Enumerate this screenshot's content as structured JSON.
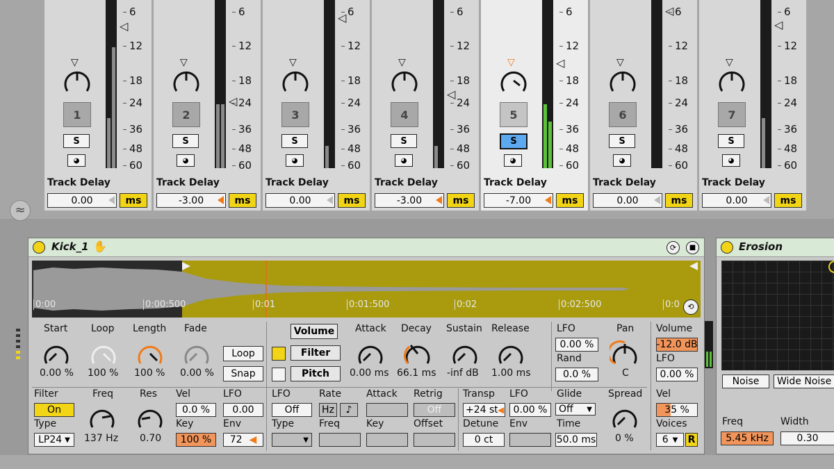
{
  "mixer": {
    "scale": [
      "6",
      "12",
      "18",
      "24",
      "36",
      "48",
      "60"
    ],
    "track_delay_label": "Track Delay",
    "solo_label": "S",
    "ms_label": "ms",
    "tracks": [
      {
        "number": "1",
        "delay": "0.00",
        "selected": false,
        "solo_on": false
      },
      {
        "number": "2",
        "delay": "-3.00",
        "selected": false,
        "solo_on": false
      },
      {
        "number": "3",
        "delay": "0.00",
        "selected": false,
        "solo_on": false
      },
      {
        "number": "4",
        "delay": "-3.00",
        "selected": false,
        "solo_on": false
      },
      {
        "number": "5",
        "delay": "-7.00",
        "selected": true,
        "solo_on": true
      },
      {
        "number": "6",
        "delay": "0.00",
        "selected": false,
        "solo_on": false
      },
      {
        "number": "7",
        "delay": "0.00",
        "selected": false,
        "solo_on": false
      }
    ]
  },
  "simpler": {
    "title": "Kick_1",
    "timeline": [
      "0:00",
      "0:00:500",
      "0:01",
      "0:01:500",
      "0:02",
      "0:02:500",
      "0:0"
    ],
    "sample": {
      "start_label": "Start",
      "start_value": "0.00 %",
      "loop_label": "Loop",
      "loop_value": "100 %",
      "length_label": "Length",
      "length_value": "100 %",
      "fade_label": "Fade",
      "fade_value": "0.00 %",
      "loop_btn": "Loop",
      "snap_btn": "Snap"
    },
    "tabs": {
      "volume": "Volume",
      "filter": "Filter",
      "pitch": "Pitch"
    },
    "envelope": {
      "attack_label": "Attack",
      "attack_value": "0.00 ms",
      "decay_label": "Decay",
      "decay_value": "66.1 ms",
      "sustain_label": "Sustain",
      "sustain_value": "-inf dB",
      "release_label": "Release",
      "release_value": "1.00 ms"
    },
    "lfo_top": {
      "lfo_label": "LFO",
      "lfo_value": "0.00 %",
      "rand_label": "Rand",
      "rand_value": "0.0 %"
    },
    "pan": {
      "label": "Pan",
      "value": "C"
    },
    "volume": {
      "label": "Volume",
      "value": "-12.0 dB",
      "lfo_label": "LFO",
      "lfo_value": "0.00 %"
    },
    "filter": {
      "filter_label": "Filter",
      "on_label": "On",
      "type_label": "Type",
      "type_value": "LP24",
      "freq_label": "Freq",
      "freq_value": "137 Hz",
      "res_label": "Res",
      "res_value": "0.70",
      "vel_label": "Vel",
      "vel_value": "0.0 %",
      "lfo_label": "LFO",
      "lfo_value": "0.00",
      "key_label": "Key",
      "key_value": "100 %",
      "env_label": "Env",
      "env_value": "72"
    },
    "lfo_section": {
      "lfo_label": "LFO",
      "lfo_value": "Off",
      "rate_label": "Rate",
      "hz": "Hz",
      "note": "♪",
      "attack_label": "Attack",
      "retrig_label": "Retrig",
      "retrig_value": "Off",
      "type_label": "Type",
      "freq_label": "Freq",
      "key_label": "Key",
      "offset_label": "Offset"
    },
    "pitch": {
      "transp_label": "Transp",
      "transp_value": "+24 st",
      "lfo_label": "LFO",
      "lfo_value": "0.00 %",
      "detune_label": "Detune",
      "detune_value": "0 ct",
      "env_label": "Env"
    },
    "glide": {
      "label": "Glide",
      "value": "Off",
      "time_label": "Time",
      "time_value": "50.0 ms"
    },
    "spread": {
      "label": "Spread",
      "value": "0 %"
    },
    "voice": {
      "vel_label": "Vel",
      "vel_value": "35 %",
      "voices_label": "Voices",
      "voices_value": "6",
      "r_label": "R"
    }
  },
  "erosion": {
    "title": "Erosion",
    "noise": "Noise",
    "wide_noise": "Wide Noise",
    "freq_label": "Freq",
    "freq_value": "5.45 kHz",
    "width_label": "Width",
    "width_value": "0.30"
  }
}
